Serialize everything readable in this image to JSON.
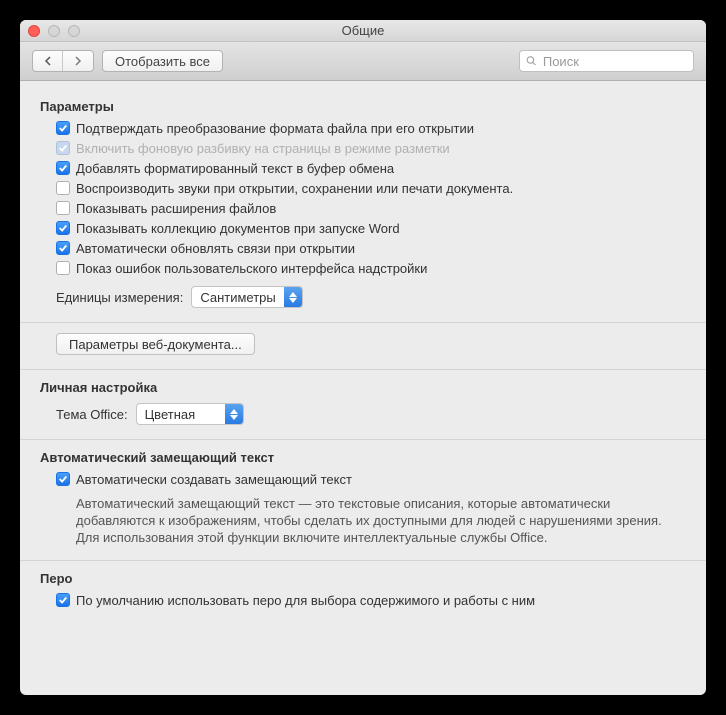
{
  "window": {
    "title": "Общие"
  },
  "toolbar": {
    "show_all": "Отобразить все",
    "search_placeholder": "Поиск"
  },
  "sections": {
    "params": {
      "title": "Параметры",
      "items": [
        {
          "label": "Подтверждать преобразование формата файла при его открытии",
          "checked": true,
          "disabled": false
        },
        {
          "label": "Включить фоновую разбивку на страницы в режиме разметки",
          "checked": true,
          "disabled": true
        },
        {
          "label": "Добавлять форматированный текст в буфер обмена",
          "checked": true,
          "disabled": false
        },
        {
          "label": "Воспроизводить звуки при открытии, сохранении или печати документа.",
          "checked": false,
          "disabled": false
        },
        {
          "label": "Показывать расширения файлов",
          "checked": false,
          "disabled": false
        },
        {
          "label": "Показывать коллекцию документов при запуске Word",
          "checked": true,
          "disabled": false
        },
        {
          "label": "Автоматически обновлять связи при открытии",
          "checked": true,
          "disabled": false
        },
        {
          "label": "Показ ошибок пользовательского интерфейса надстройки",
          "checked": false,
          "disabled": false
        }
      ],
      "units_label": "Единицы измерения:",
      "units_value": "Сантиметры",
      "web_button": "Параметры веб-документа..."
    },
    "personal": {
      "title": "Личная настройка",
      "theme_label": "Тема Office:",
      "theme_value": "Цветная"
    },
    "alttext": {
      "title": "Автоматический замещающий текст",
      "checkbox_label": "Автоматически создавать замещающий текст",
      "checkbox_checked": true,
      "description": "Автоматический замещающий текст — это текстовые описания, которые автоматически добавляются к изображениям, чтобы сделать их доступными для людей с нарушениями зрения. Для использования этой функции включите интеллектуальные службы Office."
    },
    "pen": {
      "title": "Перо",
      "checkbox_label": "По умолчанию использовать перо для выбора содержимого и работы с ним",
      "checkbox_checked": true
    }
  }
}
